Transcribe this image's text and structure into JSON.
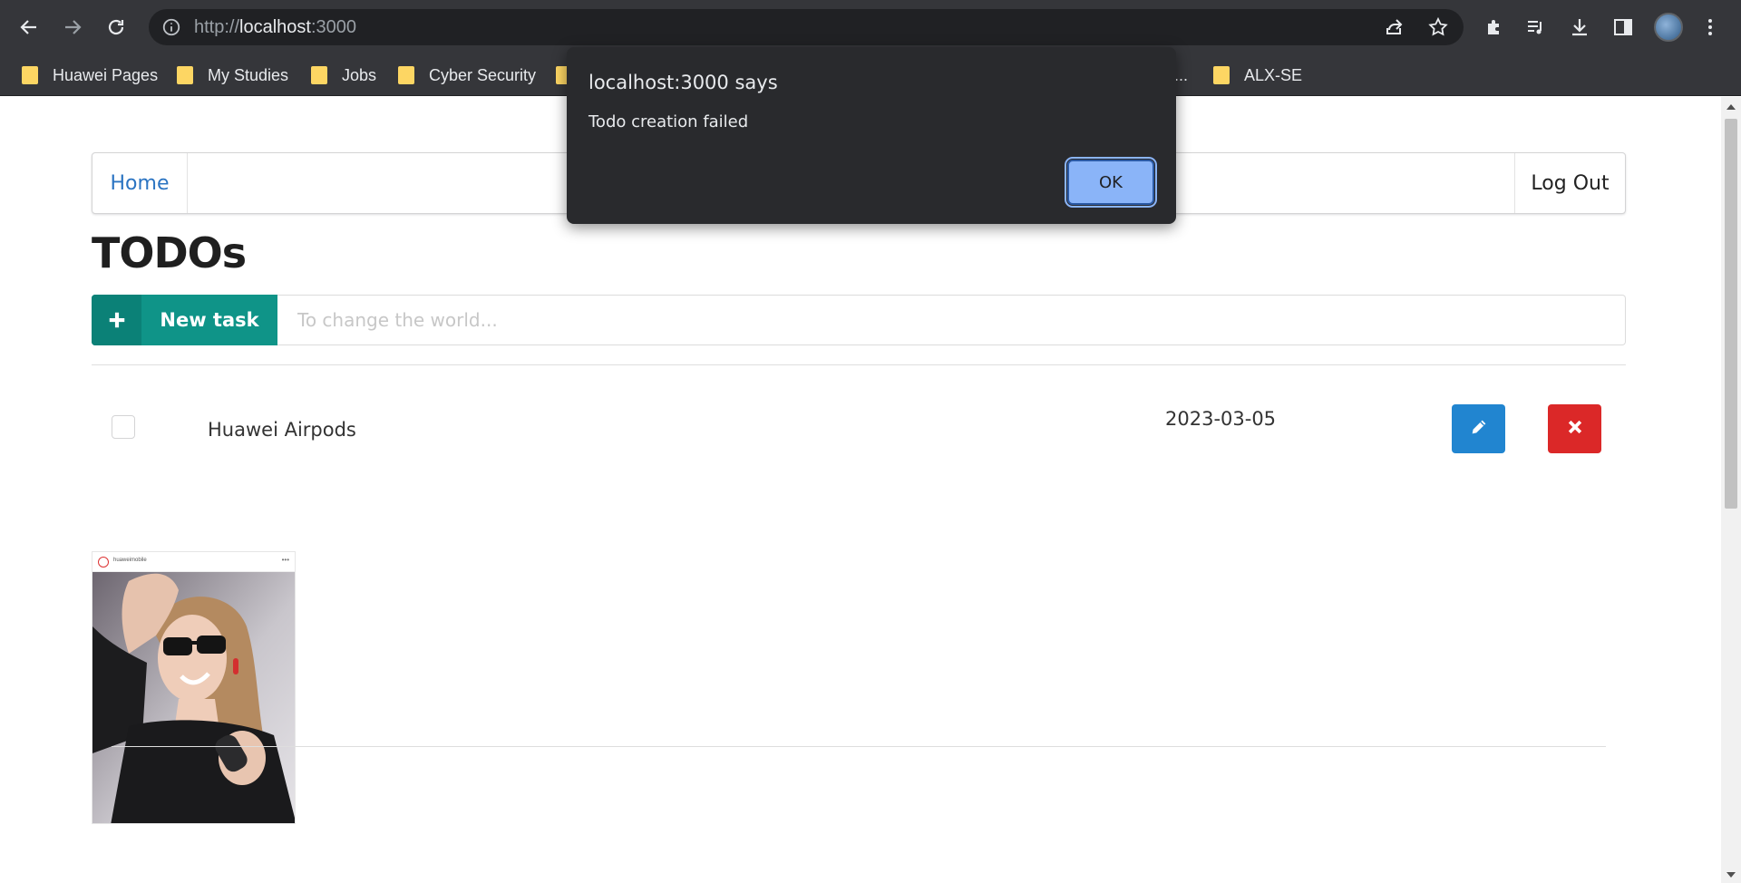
{
  "browser": {
    "url_scheme": "http://",
    "url_host": "localhost",
    "url_port": ":3000",
    "bookmarks": [
      {
        "label": "Huawei Pages"
      },
      {
        "label": "My Studies"
      },
      {
        "label": "Jobs"
      },
      {
        "label": "Cyber Security"
      },
      {
        "label": ""
      },
      {
        "label": "..."
      },
      {
        "label": "ALX-SE"
      }
    ]
  },
  "dialog": {
    "title": "localhost:3000 says",
    "message": "Todo creation failed",
    "ok_label": "OK"
  },
  "nav": {
    "home_label": "Home",
    "logout_label": "Log Out"
  },
  "page": {
    "title": "TODOs",
    "new_task_label": "New task",
    "input_placeholder": "To change the world..."
  },
  "todos": [
    {
      "title": "Huawei Airpods",
      "date": "2023-03-05",
      "checked": false,
      "image_header": "huaweimobile"
    }
  ],
  "colors": {
    "teal": "#0f9488",
    "edit_blue": "#2185d0",
    "delete_red": "#db2828",
    "link_blue": "#2b74c2",
    "dialog_bg": "#292a2d",
    "dialog_button": "#8ab4f8"
  },
  "icons": {
    "back": "arrow-left-icon",
    "forward": "arrow-right-icon",
    "reload": "reload-icon",
    "site_info": "info-icon",
    "share": "share-icon",
    "bookmark": "star-icon",
    "extensions": "puzzle-icon",
    "media": "playlist-icon",
    "downloads": "download-icon",
    "side_panel": "side-panel-icon",
    "menu": "kebab-menu-icon",
    "add": "plus-icon",
    "edit": "pencil-icon",
    "delete": "close-icon"
  }
}
